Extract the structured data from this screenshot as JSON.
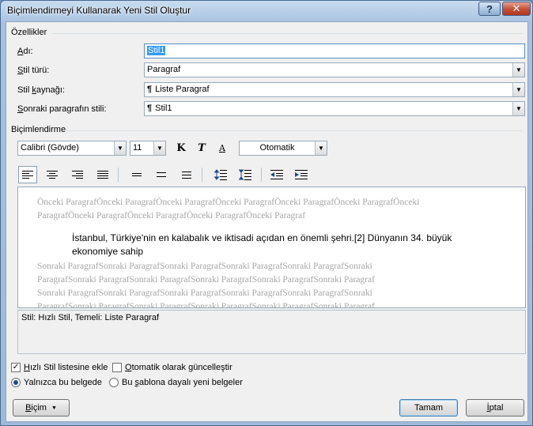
{
  "window": {
    "title": "Biçimlendirmeyi Kullanarak Yeni Stil Oluştur"
  },
  "properties": {
    "section": "Özellikler",
    "name": {
      "label_u": "A",
      "label_rest": "dı:",
      "value": "Stil1"
    },
    "style_type": {
      "label_u": "S",
      "label_rest": "til türü:",
      "value": "Paragraf"
    },
    "style_base": {
      "label_pre": "Stil ",
      "label_u": "k",
      "label_rest": "aynağı:",
      "value": "Liste Paragraf"
    },
    "next_style": {
      "label_u": "S",
      "label_rest": "onraki paragrafın stili:",
      "value": "Stil1"
    }
  },
  "formatting": {
    "section": "Biçimlendirme",
    "font": "Calibri (Gövde)",
    "size": "11",
    "bold": "K",
    "italic": "T",
    "underline": "A",
    "color": "Otomatik"
  },
  "preview": {
    "prev_line1": "Önceki ParagrafÖnceki ParagrafÖnceki ParagrafÖnceki ParagrafÖnceki ParagrafÖnceki ParagrafÖnceki",
    "prev_line2": "ParagrafÖnceki ParagrafÖnceki ParagrafÖnceki ParagrafÖnceki Paragraf",
    "main": "İstanbul, Türkiye'nin en kalabalık ve iktisadi açıdan en önemli şehri.[2] Dünyanın 34. büyük ekonomiye sahip",
    "next_line1": "Sonraki ParagrafSonraki ParagrafSonraki ParagrafSonraki ParagrafSonraki ParagrafSonraki",
    "next_line2": "ParagrafSonraki ParagrafSonraki ParagrafSonraki ParagrafSonraki ParagrafSonraki Paragraf",
    "next_line3": "Sonraki ParagrafSonraki ParagrafSonraki ParagrafSonraki ParagrafSonraki ParagrafSonraki",
    "next_line4": "ParagrafSonraki ParagrafSonraki ParagrafSonraki ParagrafSonraki ParagrafSonraki Paragraf"
  },
  "description": "Stil: Hızlı Stil, Temeli: Liste Paragraf",
  "options": {
    "quick_style": {
      "label_u": "H",
      "label_rest": "ızlı Stil listesine ekle",
      "checked": true
    },
    "auto_update": {
      "label_u": "O",
      "label_rest": "tomatik olarak güncelleştir",
      "checked": false
    },
    "only_doc": {
      "label": "Yalnızca bu belgede",
      "selected": true
    },
    "new_docs": {
      "label_pre": "Bu ",
      "label_u": "ş",
      "label_rest": "ablona dayalı yeni belgeler",
      "selected": false
    }
  },
  "buttons": {
    "format_u": "B",
    "format_rest": "içim",
    "format_arrow": "▼",
    "ok": "Tamam",
    "cancel_u": "İ",
    "cancel_rest": "ptal"
  },
  "icons": {
    "check_mark": "✓",
    "help": "?",
    "close": "✕",
    "pilcrow": "¶",
    "dropdown": "▼"
  }
}
